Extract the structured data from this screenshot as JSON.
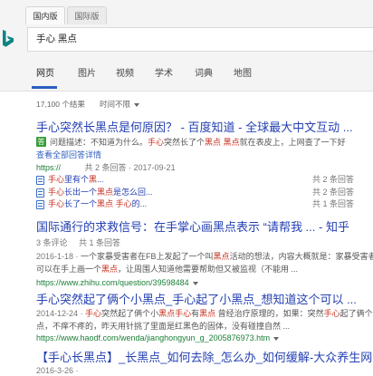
{
  "header": {
    "region_tabs": {
      "domestic": "国内版",
      "international": "国际版"
    },
    "search_query": "手心 黑点",
    "nav": {
      "web": "网页",
      "images": "图片",
      "videos": "视频",
      "academic": "学术",
      "dictionary": "词典",
      "maps": "地图"
    }
  },
  "toolbar": {
    "result_count": "17,100 个结果",
    "time_filter": "时间不限"
  },
  "icons": {
    "logo": "bing-logo-icon",
    "answer": "answer-badge",
    "related": "document-icon",
    "caret": "chevron-down-icon"
  },
  "colors": {
    "title": "#2541b2",
    "highlight": "#c8311f",
    "url": "#1a7f37",
    "snippet": "#555555",
    "answer_badge": "#3a9d3a",
    "nav_active": "#2a5fbf"
  },
  "results": [
    {
      "title": "手心突然长黑点是何原因？ - 百度知道 - 全球最大中文互动 ...",
      "answer_badge": "答",
      "answer_snippet": [
        {
          "t": "问题描述：不知道为什么。"
        },
        {
          "t": "手心",
          "hl": true
        },
        {
          "t": "突然长了个"
        },
        {
          "t": "黑点",
          "hl": true
        },
        {
          "t": " "
        },
        {
          "t": "黑点",
          "hl": true
        },
        {
          "t": "就在表皮上，上网查了一下好"
        }
      ],
      "view_all": "查看全部回答详情",
      "url": "https://",
      "meta": "共 2 条回答 · 2017-09-21",
      "related": [
        {
          "segments": [
            {
              "t": "手心",
              "hl": true
            },
            {
              "t": "里有个"
            },
            {
              "t": "黑",
              "hl": true
            },
            {
              "t": "..."
            }
          ],
          "count": "共 2 条回答"
        },
        {
          "segments": [
            {
              "t": "手心",
              "hl": true
            },
            {
              "t": "长出一个"
            },
            {
              "t": "黑点",
              "hl": true
            },
            {
              "t": "是怎么回..."
            }
          ],
          "count": "共 2 条回答"
        },
        {
          "segments": [
            {
              "t": "手心",
              "hl": true
            },
            {
              "t": "长了一个"
            },
            {
              "t": "黑点",
              "hl": true
            },
            {
              "t": " "
            },
            {
              "t": "手心",
              "hl": true
            },
            {
              "t": "的..."
            }
          ],
          "count": "共 1 条回答"
        }
      ]
    },
    {
      "title": "国际通行的求救信号：在手掌心画黑点表示 “请帮我 ... - 知乎",
      "comments": "3 条评论",
      "answers": "共 1 条回答",
      "snippet": [
        [
          {
            "t": "2016-1-18 · ",
            "d": true
          },
          {
            "t": "一个家暴受害者在FB上发起了一个叫"
          },
          {
            "t": "黑点",
            "hl": true
          },
          {
            "t": "活动的想法，内容大概就是：家暴受害者"
          }
        ],
        [
          {
            "t": "可以在手上画一个"
          },
          {
            "t": "黑点",
            "hl": true
          },
          {
            "t": "，让周围人知道他需要帮助但又被监视（不能用 ..."
          }
        ]
      ],
      "url": "https://www.zhihu.com/question/39598484"
    },
    {
      "title": "手心突然起了俩个小黑点_手心起了小黑点_想知道这个可以 ...",
      "snippet": [
        [
          {
            "t": "2014-12-24 · ",
            "d": true
          },
          {
            "t": "手心",
            "hl": true
          },
          {
            "t": "突然起了俩个小"
          },
          {
            "t": "黑点",
            "hl": true
          },
          {
            "t": "手心",
            "hl": true
          },
          {
            "t": "有"
          },
          {
            "t": "黑点",
            "hl": true
          },
          {
            "t": " 曾经治疗原理的，如果：突然"
          },
          {
            "t": "手心",
            "hl": true
          },
          {
            "t": "起了俩个小黑"
          }
        ],
        [
          {
            "t": "点，不痒不疼的，昨天用针挑了里面是红黑色的固体，没有碰撞自然 ..."
          }
        ]
      ],
      "url": "https://www.haodf.com/wenda/jianghongyun_g_2005876973.htm"
    },
    {
      "title": "【手心长黑点】_长黑点_如何去除_怎么办_如何缓解-大众养生网",
      "snippet": [
        [
          {
            "t": "2016-3-26 · ",
            "d": true
          }
        ]
      ]
    }
  ]
}
